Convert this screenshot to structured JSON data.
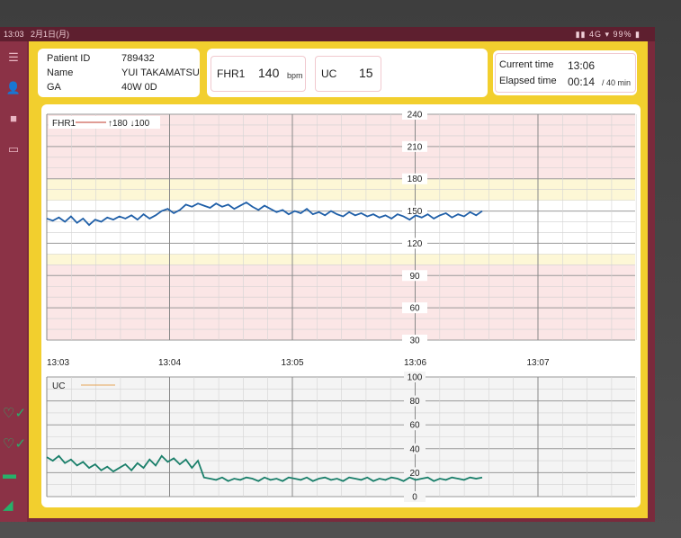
{
  "status_bar": {
    "time": "13:03",
    "date": "2月1日(月)",
    "right": "▮▮ 4G ▾ 99% ▮"
  },
  "patient": {
    "id_label": "Patient ID",
    "id_value": "789432",
    "name_label": "Name",
    "name_value": "YUI TAKAMATSU",
    "ga_label": "GA",
    "ga_value": "40W 0D"
  },
  "fhr": {
    "label": "FHR1",
    "value": "140",
    "unit": "bpm"
  },
  "uc": {
    "label": "UC",
    "value": "15"
  },
  "time_info": {
    "current_label": "Current time",
    "current_value": "13:06",
    "elapsed_label": "Elapsed time",
    "elapsed_value": "00:14",
    "elapsed_total": "/ 40 min"
  },
  "colors": {
    "frame": "#f2cf2e",
    "rail": "#8b3246",
    "fhr_line": "#1f5fa8",
    "uc_line": "#1a7f6a",
    "danger_band": "#fbe6e6",
    "warn_band": "#fdf7d6"
  },
  "icons": [
    "menu-icon",
    "person-add-icon",
    "stop-icon",
    "folder-icon",
    "heart-check-icon",
    "heart-check-icon",
    "battery-icon",
    "signal-icon"
  ],
  "chart_data": [
    {
      "type": "line",
      "legend": "FHR1",
      "legend_limits": "↑180 ↓100",
      "ylim": [
        30,
        240
      ],
      "y_ticks": [
        "240",
        "210",
        "180",
        "150",
        "120",
        "90",
        "60",
        "30"
      ],
      "x_ticks": [
        "13:03",
        "13:04",
        "13:05",
        "13:06",
        "13:07"
      ],
      "series": [
        {
          "name": "FHR1",
          "x": [
            0,
            3,
            6,
            9,
            12,
            15,
            18,
            21,
            24,
            27,
            30,
            33,
            36,
            39,
            42,
            45,
            48,
            51,
            54,
            57,
            60,
            63,
            66,
            69,
            72,
            75,
            78,
            81,
            84,
            87,
            90,
            93,
            96,
            99,
            102,
            105,
            108,
            111,
            114,
            117,
            120,
            123,
            126,
            129,
            132,
            135,
            138,
            141,
            144,
            147,
            150,
            153,
            156,
            159,
            162,
            165,
            168,
            171,
            174,
            177,
            180,
            183,
            186,
            189,
            192,
            195,
            198,
            201,
            204,
            207,
            210,
            213,
            216
          ],
          "values": [
            143,
            141,
            144,
            140,
            145,
            139,
            143,
            137,
            142,
            140,
            144,
            142,
            145,
            143,
            146,
            142,
            147,
            143,
            146,
            150,
            152,
            148,
            151,
            156,
            154,
            157,
            155,
            153,
            157,
            154,
            156,
            152,
            155,
            158,
            154,
            151,
            155,
            152,
            149,
            151,
            147,
            150,
            148,
            152,
            147,
            149,
            146,
            150,
            147,
            145,
            149,
            146,
            148,
            145,
            147,
            144,
            146,
            143,
            147,
            145,
            142,
            146,
            144,
            147,
            143,
            146,
            148,
            144,
            147,
            145,
            149,
            146,
            150
          ]
        }
      ]
    },
    {
      "type": "line",
      "legend": "UC",
      "ylim": [
        0,
        100
      ],
      "y_ticks": [
        "100",
        "80",
        "60",
        "40",
        "20",
        "0"
      ],
      "x_ticks": [],
      "series": [
        {
          "name": "UC",
          "x": [
            0,
            3,
            6,
            9,
            12,
            15,
            18,
            21,
            24,
            27,
            30,
            33,
            36,
            39,
            42,
            45,
            48,
            51,
            54,
            57,
            60,
            63,
            66,
            69,
            72,
            75,
            78,
            81,
            84,
            87,
            90,
            93,
            96,
            99,
            102,
            105,
            108,
            111,
            114,
            117,
            120,
            123,
            126,
            129,
            132,
            135,
            138,
            141,
            144,
            147,
            150,
            153,
            156,
            159,
            162,
            165,
            168,
            171,
            174,
            177,
            180,
            183,
            186,
            189,
            192,
            195,
            198,
            201,
            204,
            207,
            210,
            213,
            216
          ],
          "values": [
            33,
            30,
            34,
            28,
            31,
            26,
            29,
            24,
            27,
            22,
            25,
            21,
            24,
            27,
            22,
            28,
            24,
            31,
            26,
            34,
            29,
            32,
            27,
            31,
            24,
            30,
            16,
            15,
            14,
            16,
            13,
            15,
            14,
            16,
            15,
            13,
            16,
            14,
            15,
            13,
            16,
            15,
            14,
            16,
            13,
            15,
            16,
            14,
            15,
            13,
            16,
            15,
            14,
            16,
            13,
            15,
            14,
            16,
            15,
            13,
            16,
            14,
            15,
            16,
            13,
            15,
            14,
            16,
            15,
            14,
            16,
            15,
            16
          ]
        }
      ]
    }
  ]
}
